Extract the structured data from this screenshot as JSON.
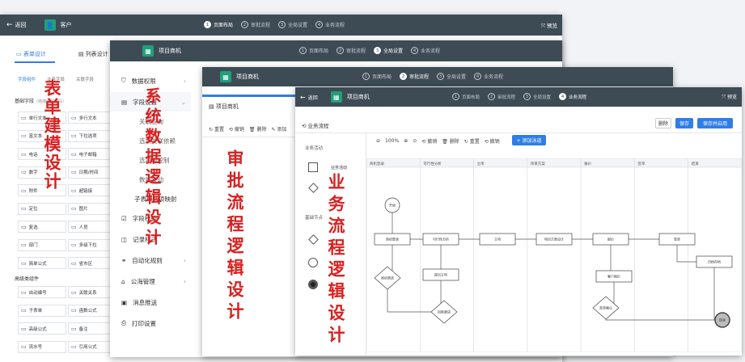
{
  "win1": {
    "back": "返回",
    "title": "客户",
    "preview": "预览",
    "steps": [
      {
        "n": "1",
        "label": "页面布局"
      },
      {
        "n": "2",
        "label": "审批流程"
      },
      {
        "n": "3",
        "label": "全局设置"
      },
      {
        "n": "4",
        "label": "业务流程"
      }
    ],
    "tabs": [
      "表单设计",
      "列表设计"
    ],
    "subtabs": [
      "字段组件",
      "业务字段",
      "关联字段"
    ],
    "group_basic": "基础字段",
    "group_basic_hint": "（拖拽添加字段）",
    "group_adv": "高级类组件",
    "fields": [
      [
        "单行文本",
        "多行文本"
      ],
      [
        "富文本",
        "下拉选项"
      ],
      [
        "电话",
        "电子邮箱"
      ],
      [
        "数字",
        "日期/时间"
      ],
      [
        "附件",
        "超链接"
      ],
      [
        "定位",
        "图片"
      ],
      [
        "复选",
        "人员"
      ],
      [
        "部门",
        "多级下拉"
      ],
      [
        "简单公式",
        "省市区"
      ]
    ],
    "adv": [
      [
        "自动编号",
        "关联关系"
      ],
      [
        "子表单",
        "函数公式"
      ],
      [
        "高级公式",
        "备注"
      ],
      [
        "流水号",
        "引用公式"
      ]
    ],
    "label": "表单建模设计"
  },
  "win2": {
    "title": "项目商机",
    "steps": [
      {
        "n": "1",
        "label": "页面布局"
      },
      {
        "n": "2",
        "label": "审批流程"
      },
      {
        "n": "3",
        "label": "全局设置"
      },
      {
        "n": "4",
        "label": "业务流程"
      }
    ],
    "menu": [
      "数据权限",
      "字段设置",
      "",
      "",
      "",
      "",
      "",
      "子表单选项映射",
      "字段校验",
      "记录样式",
      "自动化规则",
      "公海管理",
      "消息推送",
      "打印设置"
    ],
    "sub_overlap": [
      "关联查询",
      "选项关联依赖",
      "选项值控制",
      "数据联动"
    ],
    "label": "系统数据逻辑设计"
  },
  "win3": {
    "title": "项目商机",
    "steps": [
      {
        "n": "1",
        "label": "页面布局"
      },
      {
        "n": "2",
        "label": "审批流程"
      },
      {
        "n": "3",
        "label": "全局设置"
      },
      {
        "n": "4",
        "label": "业务流程"
      }
    ],
    "panel_title": "项目商机",
    "toolbar": [
      "重置",
      "撤销",
      "删除",
      "添加"
    ],
    "label": "审批流程逻辑设计"
  },
  "win4": {
    "back": "返回",
    "title": "项目商机",
    "preview": "预览",
    "steps": [
      {
        "n": "1",
        "label": "页面布局"
      },
      {
        "n": "2",
        "label": "审批流程"
      },
      {
        "n": "3",
        "label": "全局设置"
      },
      {
        "n": "4",
        "label": "业务流程"
      }
    ],
    "page_title": "业务流程",
    "btn_delete": "删除",
    "btn_save": "保存",
    "btn_save_publish": "保存并启用",
    "zoom": "100%",
    "toolbar": [
      "撤销",
      "删除",
      "重置",
      "撤销"
    ],
    "add_lane": "+ 添加泳道",
    "palette_biz": "业务活动",
    "palette_biz_item": "业务活动",
    "palette_base": "基础节点",
    "lanes": [
      "商机登录",
      "可行性分析",
      "立项",
      "项目方案",
      "报价",
      "签单",
      "结束"
    ],
    "nodes": [
      "开始",
      "商机登录",
      "商机筛选",
      "可行性分析",
      "提出立项",
      "立项",
      "项目方案设计",
      "报价",
      "客户报价",
      "签单",
      "签单确认",
      "回款跟进",
      "归档存档",
      "结束"
    ],
    "label": "业务流程逻辑设计"
  }
}
